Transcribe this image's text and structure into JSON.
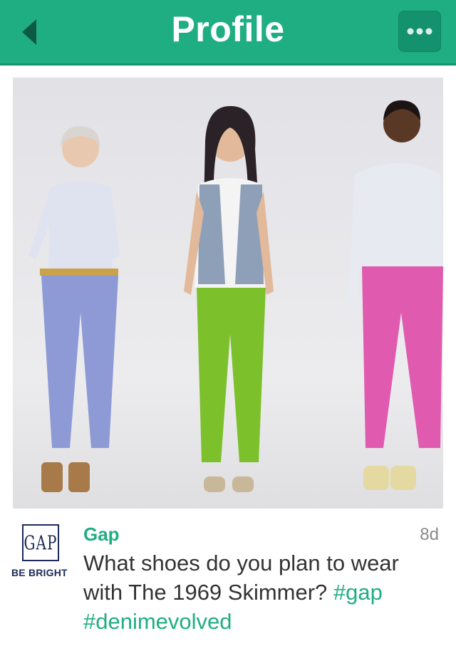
{
  "header": {
    "title": "Profile",
    "back_icon": "chevron-left-icon",
    "menu_icon": "more-dots-icon",
    "color": "#1fae82"
  },
  "post": {
    "image_description_icon": "photo",
    "brand_logo_text": "GAP",
    "brand_slogan": "BE BRIGHT",
    "author": "Gap",
    "age": "8d",
    "message_text": "What shoes do you plan to wear with The 1969 Skimmer?",
    "hashtags": [
      "#gap",
      "#denimevolved"
    ],
    "accent_color": "#1fae82"
  }
}
